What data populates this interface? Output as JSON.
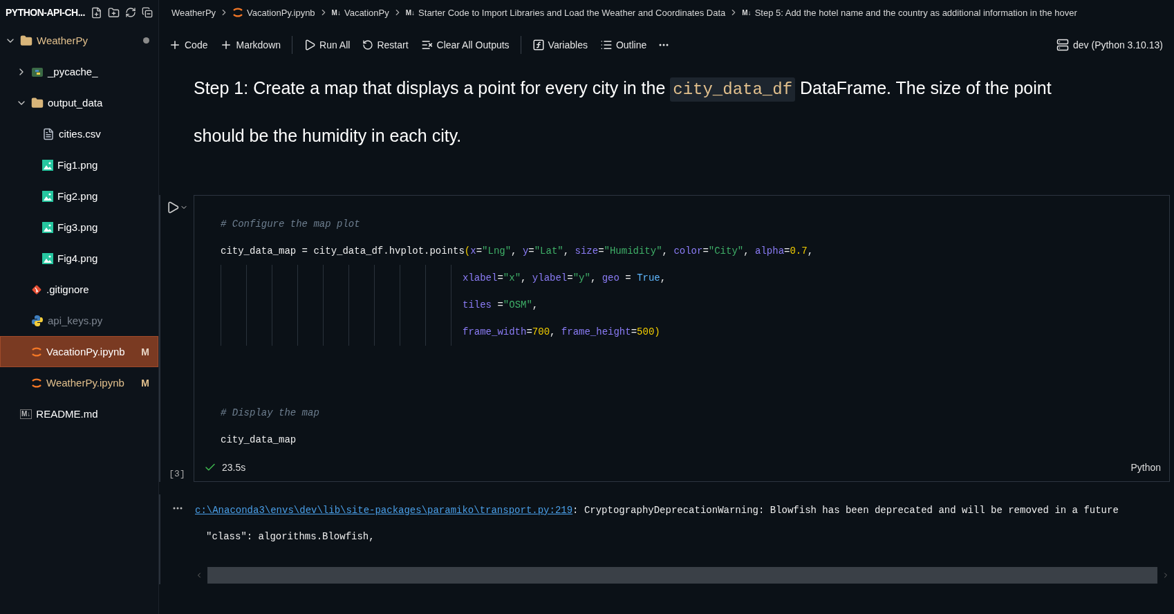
{
  "explorer": {
    "title": "PYTHON-API-CH...",
    "tree": [
      {
        "label": "WeatherPy",
        "kind": "folder",
        "expanded": true,
        "selected": false,
        "modified": true,
        "dot": true,
        "children": [
          {
            "label": "_pycache_",
            "kind": "python-package",
            "expanded": false,
            "selected": false
          },
          {
            "label": "output_data",
            "kind": "folder",
            "expanded": true,
            "selected": false,
            "children": [
              {
                "label": "cities.csv",
                "kind": "csv",
                "selected": false
              },
              {
                "label": "Fig1.png",
                "kind": "image",
                "selected": false
              },
              {
                "label": "Fig2.png",
                "kind": "image",
                "selected": false
              },
              {
                "label": "Fig3.png",
                "kind": "image",
                "selected": false
              },
              {
                "label": "Fig4.png",
                "kind": "image",
                "selected": false
              }
            ]
          },
          {
            "label": ".gitignore",
            "kind": "git",
            "selected": false
          },
          {
            "label": "api_keys.py",
            "kind": "python",
            "selected": false,
            "ignored": true
          },
          {
            "label": "VacationPy.ipynb",
            "kind": "notebook",
            "selected": true,
            "modified": true,
            "badge": "M"
          },
          {
            "label": "WeatherPy.ipynb",
            "kind": "notebook",
            "selected": false,
            "modified": true,
            "badge": "M"
          }
        ]
      },
      {
        "label": "README.md",
        "kind": "markdown",
        "selected": false,
        "marker": "M↓"
      }
    ]
  },
  "breadcrumbs": [
    {
      "label": "WeatherPy",
      "kind": "folder"
    },
    {
      "label": "VacationPy.ipynb",
      "kind": "notebook"
    },
    {
      "label": "VacationPy",
      "kind": "markdown",
      "marker": "M↓"
    },
    {
      "label": "Starter Code to Import Libraries and Load the Weather and Coordinates Data",
      "kind": "markdown",
      "marker": "M↓"
    },
    {
      "label": "Step 5: Add the hotel name and the country as additional information in the hover",
      "kind": "markdown",
      "marker": "M↓"
    }
  ],
  "toolbar": [
    {
      "label": "Code",
      "kind": "add"
    },
    {
      "label": "Markdown",
      "kind": "add"
    },
    {
      "kind": "separator"
    },
    {
      "label": "Run All",
      "kind": "run"
    },
    {
      "label": "Restart",
      "kind": "restart"
    },
    {
      "label": "Clear All Outputs",
      "kind": "clear"
    },
    {
      "kind": "separator"
    },
    {
      "label": "Variables",
      "kind": "variables"
    },
    {
      "label": "Outline",
      "kind": "outline"
    },
    {
      "kind": "more"
    }
  ],
  "kernel": "dev (Python 3.10.13)",
  "markdown_cell": {
    "before": "Step 1: Create a map that displays a point for every city in the ",
    "code": "city_data_df",
    "after": " DataFrame. The size of the point should be the humidity in each city."
  },
  "code_cell": {
    "lines": [
      {
        "kind": "code",
        "tokens": [
          {
            "kind": "comment",
            "text": "# Configure the map plot"
          }
        ]
      },
      {
        "kind": "code",
        "tokens": [
          {
            "kind": "plain",
            "text": "city_data_map = city_data_df.hvplot.points"
          },
          {
            "kind": "paren",
            "text": "("
          },
          {
            "kind": "param",
            "text": "x"
          },
          {
            "kind": "plain",
            "text": "="
          },
          {
            "kind": "string",
            "text": "\"Lng\""
          },
          {
            "kind": "plain",
            "text": ", "
          },
          {
            "kind": "param",
            "text": "y"
          },
          {
            "kind": "plain",
            "text": "="
          },
          {
            "kind": "string",
            "text": "\"Lat\""
          },
          {
            "kind": "plain",
            "text": ", "
          },
          {
            "kind": "param",
            "text": "size"
          },
          {
            "kind": "plain",
            "text": "="
          },
          {
            "kind": "string",
            "text": "\"Humidity\""
          },
          {
            "kind": "plain",
            "text": ", "
          },
          {
            "kind": "param",
            "text": "color"
          },
          {
            "kind": "plain",
            "text": "="
          },
          {
            "kind": "string",
            "text": "\"City\""
          },
          {
            "kind": "plain",
            "text": ", "
          },
          {
            "kind": "param",
            "text": "alpha"
          },
          {
            "kind": "plain",
            "text": "="
          },
          {
            "kind": "number",
            "text": "0.7"
          },
          {
            "kind": "plain",
            "text": ","
          }
        ]
      },
      {
        "kind": "continuation",
        "tokens": [
          {
            "kind": "param",
            "text": "xlabel"
          },
          {
            "kind": "plain",
            "text": "="
          },
          {
            "kind": "string",
            "text": "\"x\""
          },
          {
            "kind": "plain",
            "text": ", "
          },
          {
            "kind": "param",
            "text": "ylabel"
          },
          {
            "kind": "plain",
            "text": "="
          },
          {
            "kind": "string",
            "text": "\"y\""
          },
          {
            "kind": "plain",
            "text": ", "
          },
          {
            "kind": "param",
            "text": "geo"
          },
          {
            "kind": "plain",
            "text": " = "
          },
          {
            "kind": "keyword",
            "text": "True"
          },
          {
            "kind": "plain",
            "text": ","
          }
        ]
      },
      {
        "kind": "continuation",
        "tokens": [
          {
            "kind": "param",
            "text": "tiles"
          },
          {
            "kind": "plain",
            "text": " ="
          },
          {
            "kind": "string",
            "text": "\"OSM\""
          },
          {
            "kind": "plain",
            "text": ","
          }
        ]
      },
      {
        "kind": "continuation",
        "tokens": [
          {
            "kind": "param",
            "text": "frame_width"
          },
          {
            "kind": "plain",
            "text": "="
          },
          {
            "kind": "number",
            "text": "700"
          },
          {
            "kind": "plain",
            "text": ", "
          },
          {
            "kind": "param",
            "text": "frame_height"
          },
          {
            "kind": "plain",
            "text": "="
          },
          {
            "kind": "number",
            "text": "500"
          },
          {
            "kind": "paren",
            "text": ")"
          }
        ]
      },
      {
        "kind": "blank"
      },
      {
        "kind": "blank"
      },
      {
        "kind": "code",
        "tokens": [
          {
            "kind": "comment",
            "text": "# Display the map"
          }
        ]
      },
      {
        "kind": "code",
        "tokens": [
          {
            "kind": "plain",
            "text": "city_data_map"
          }
        ]
      }
    ],
    "count": "[3]",
    "succeeded": true,
    "duration": "23.5s",
    "language": "Python"
  },
  "output": [
    {
      "kind": "warning",
      "link": "c:\\Anaconda3\\envs\\dev\\lib\\site-packages\\paramiko\\transport.py:219",
      "text": ": CryptographyDeprecationWarning: Blowfish has been deprecated and will be removed in a future"
    },
    {
      "kind": "plain",
      "text": "\"class\": algorithms.Blowfish,"
    }
  ]
}
